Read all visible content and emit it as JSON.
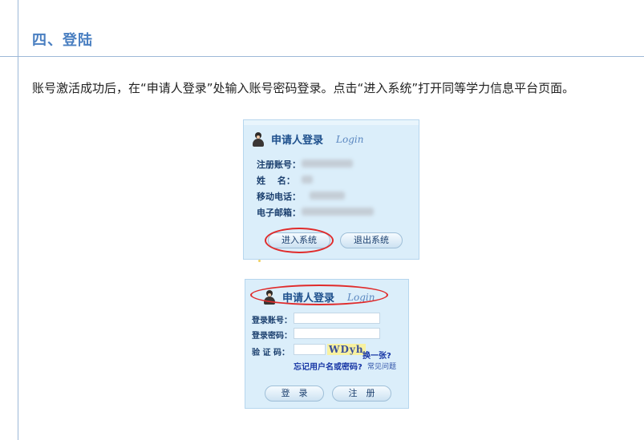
{
  "section": {
    "heading": "四、登陆",
    "paragraph": "账号激活成功后，在“申请人登录”处输入账号密码登录。点击“进入系统”打开同等学力信息平台页面。"
  },
  "panel1": {
    "title_cn": "申请人登录",
    "title_en": "Login",
    "fields": [
      {
        "label": "注册账号："
      },
      {
        "label": "姓　 名："
      },
      {
        "label": "移动电话："
      },
      {
        "label": "电子邮箱："
      }
    ],
    "enter_button": "进入系统",
    "exit_button": "退出系统"
  },
  "panel2": {
    "title_cn": "申请人登录",
    "title_en": "Login",
    "account_label": "登录账号：",
    "password_label": "登录密码：",
    "captcha_label": "验 证 码：",
    "captcha_text": "WDyh",
    "refresh_captcha": "换一张?",
    "forgot_link": "忘记用户名或密码?",
    "faq_link": "常见问题",
    "login_button": "登　录",
    "register_button": "注　册"
  },
  "colors": {
    "heading": "#4a7fc1",
    "panel_bg": "#dbeefa",
    "highlight": "#e02b2b"
  }
}
